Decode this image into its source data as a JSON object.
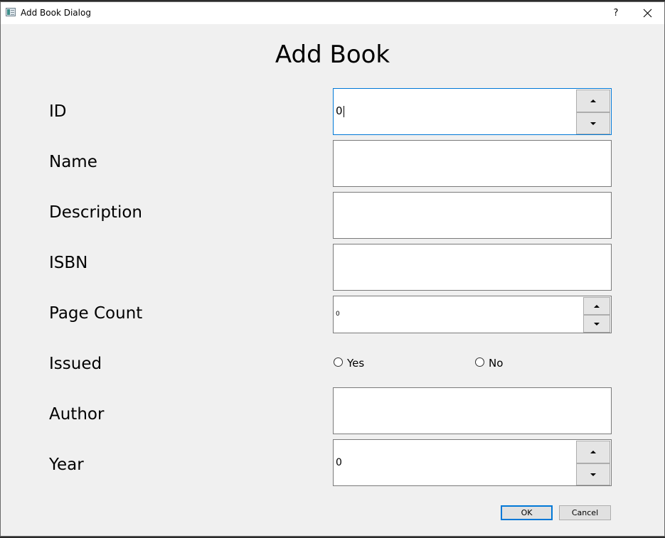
{
  "window": {
    "title": "Add Book Dialog",
    "help_label": "?"
  },
  "heading": "Add Book",
  "fields": {
    "id": {
      "label": "ID",
      "value": "0"
    },
    "name": {
      "label": "Name",
      "value": ""
    },
    "description": {
      "label": "Description",
      "value": ""
    },
    "isbn": {
      "label": "ISBN",
      "value": ""
    },
    "page_count": {
      "label": "Page Count",
      "value": "0"
    },
    "issued": {
      "label": "Issued",
      "options": [
        "Yes",
        "No"
      ]
    },
    "author": {
      "label": "Author",
      "value": ""
    },
    "year": {
      "label": "Year",
      "value": "0"
    }
  },
  "buttons": {
    "ok": "OK",
    "cancel": "Cancel"
  },
  "colors": {
    "focus": "#0078d7",
    "background": "#f0f0f0"
  }
}
